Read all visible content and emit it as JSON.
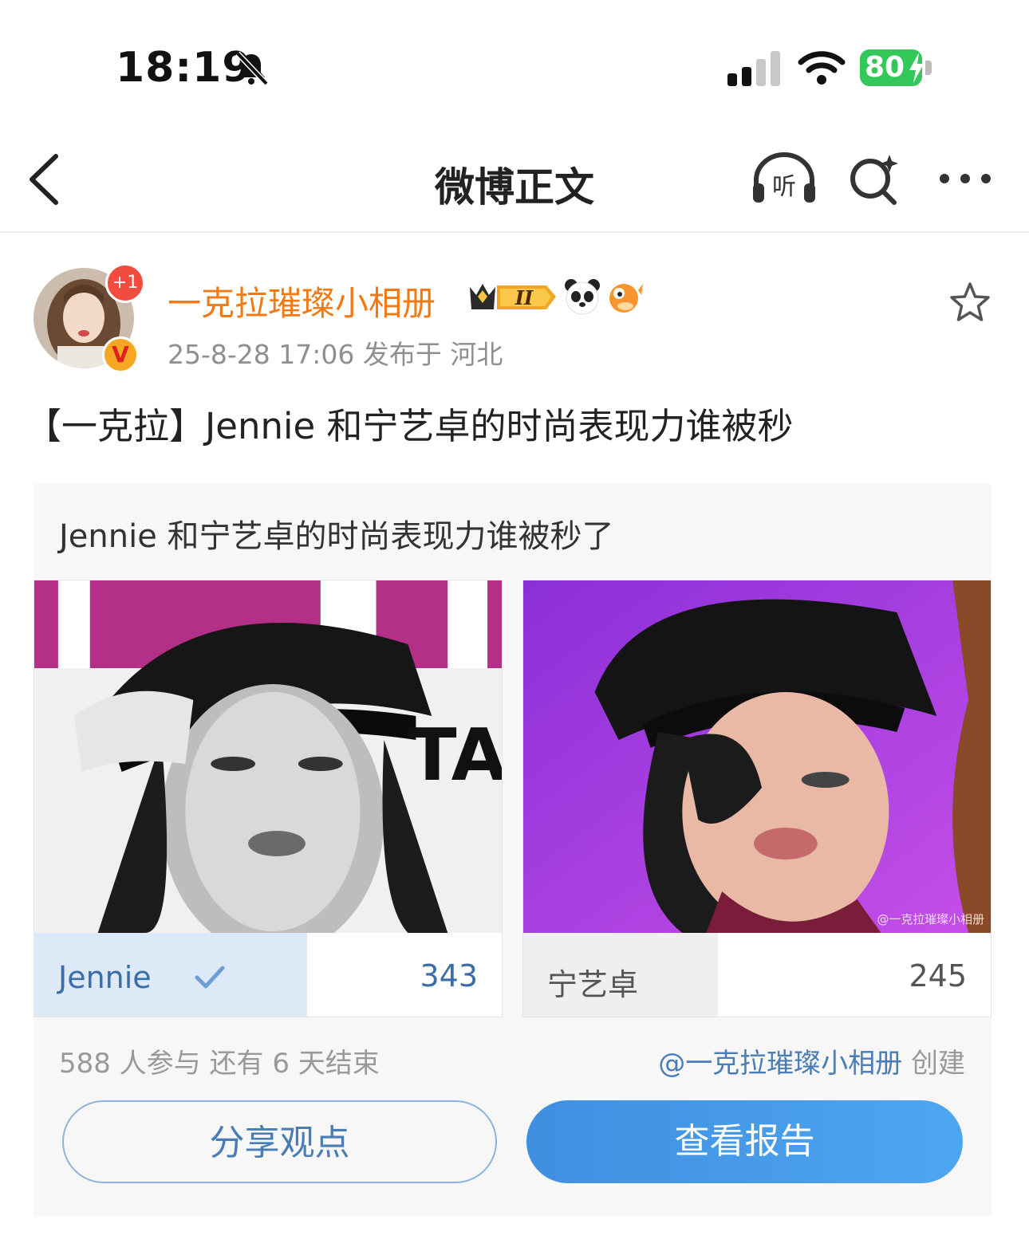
{
  "status_bar": {
    "time": "18:19",
    "battery": "80",
    "battery_color": "#34c759"
  },
  "nav": {
    "title": "微博正文",
    "listen_label": "听"
  },
  "post": {
    "username": "一克拉璀璨小相册",
    "avatar_badge": "+1",
    "verified_mark": "V",
    "username_color": "#f07a16",
    "meta": "25-8-28 17:06  发布于 河北",
    "text": "【一克拉】Jennie 和宁艺卓的时尚表现力谁被秒"
  },
  "poll": {
    "question": "Jennie 和宁艺卓的时尚表现力谁被秒了",
    "options": [
      {
        "label": "Jennie",
        "count": "343",
        "share": 0.583,
        "selected": true
      },
      {
        "label": "宁艺卓",
        "count": "245",
        "share": 0.417,
        "selected": false
      }
    ],
    "stats": "588 人参与   还有 6 天结束",
    "creator_handle": "@一克拉璀璨小相册",
    "creator_suffix": " 创建",
    "watermark": "@一克拉璀璨小相册",
    "share_button": "分享观点",
    "report_button": "查看报告",
    "accent_color": "#4a7cb6"
  }
}
